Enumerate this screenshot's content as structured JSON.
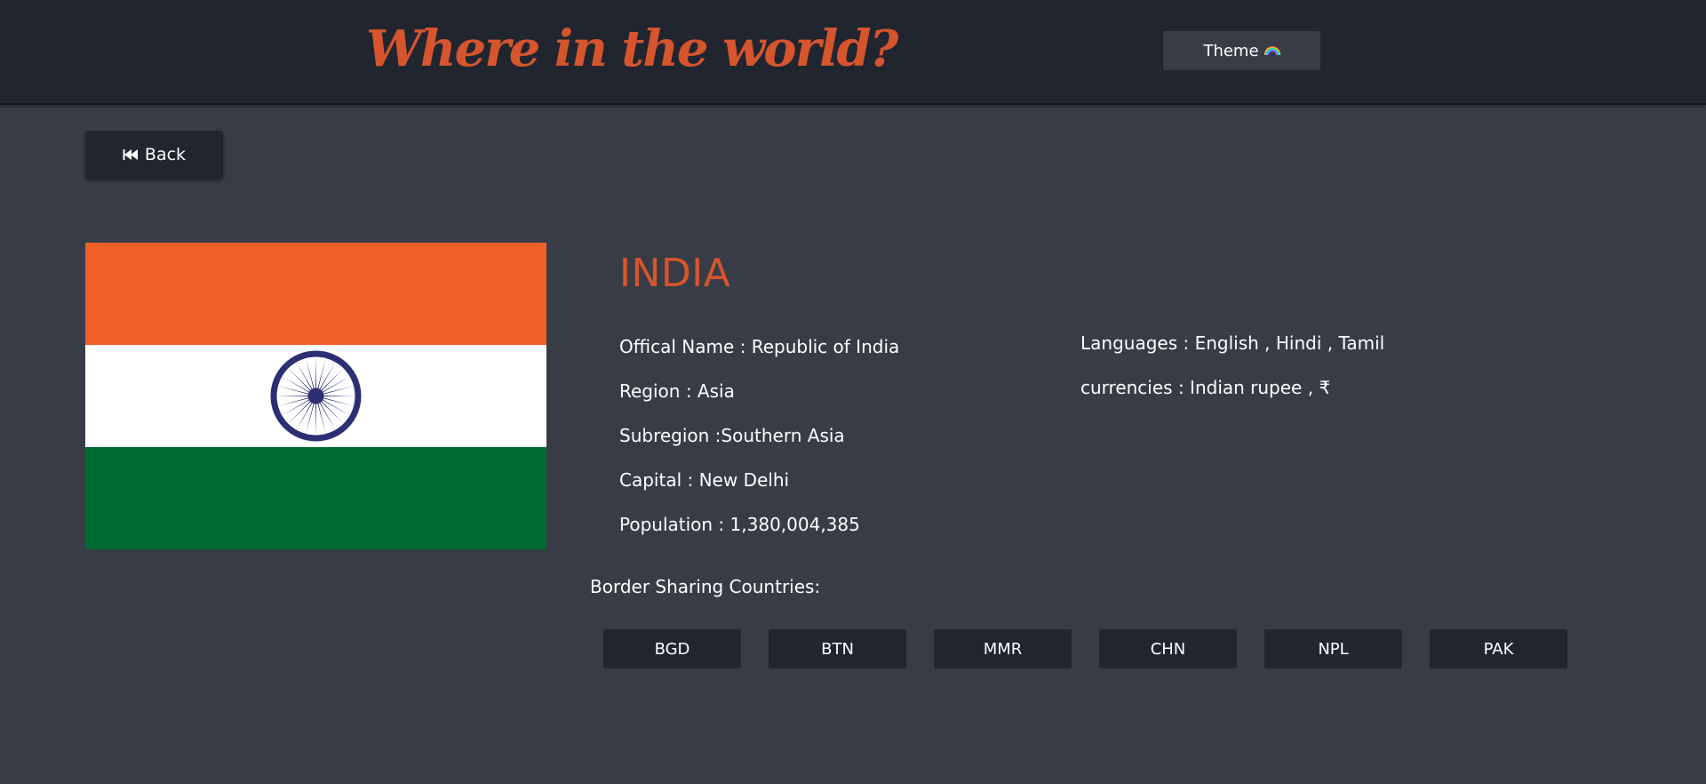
{
  "header": {
    "title": "Where in the world?",
    "theme_label": "Theme",
    "theme_icon": "rainbow-icon"
  },
  "back": {
    "label": "Back",
    "icon": "fast-backward-icon"
  },
  "country": {
    "name": "INDIA",
    "flag": {
      "colors": [
        "#f15f29",
        "#ffffff",
        "#006a33"
      ],
      "chakra_color": "#2c2f74"
    },
    "details_left": [
      {
        "label": "Offical Name : ",
        "value": "Republic of India"
      },
      {
        "label": "Region : ",
        "value": "Asia"
      },
      {
        "label": "Subregion :",
        "value": "Southern Asia"
      },
      {
        "label": "Capital : ",
        "value": "New Delhi"
      },
      {
        "label": "Population : ",
        "value": "1,380,004,385"
      }
    ],
    "details_right": [
      {
        "label": "Languages : ",
        "value": "English , Hindi , Tamil"
      },
      {
        "label": "currencies : ",
        "value": "Indian rupee , ₹"
      }
    ],
    "border_label": "Border Sharing Countries:",
    "borders": [
      "BGD",
      "BTN",
      "MMR",
      "CHN",
      "NPL",
      "PAK"
    ]
  },
  "colors": {
    "accent": "#d6552d",
    "header_bg": "#21252f",
    "page_bg": "#383c46"
  }
}
